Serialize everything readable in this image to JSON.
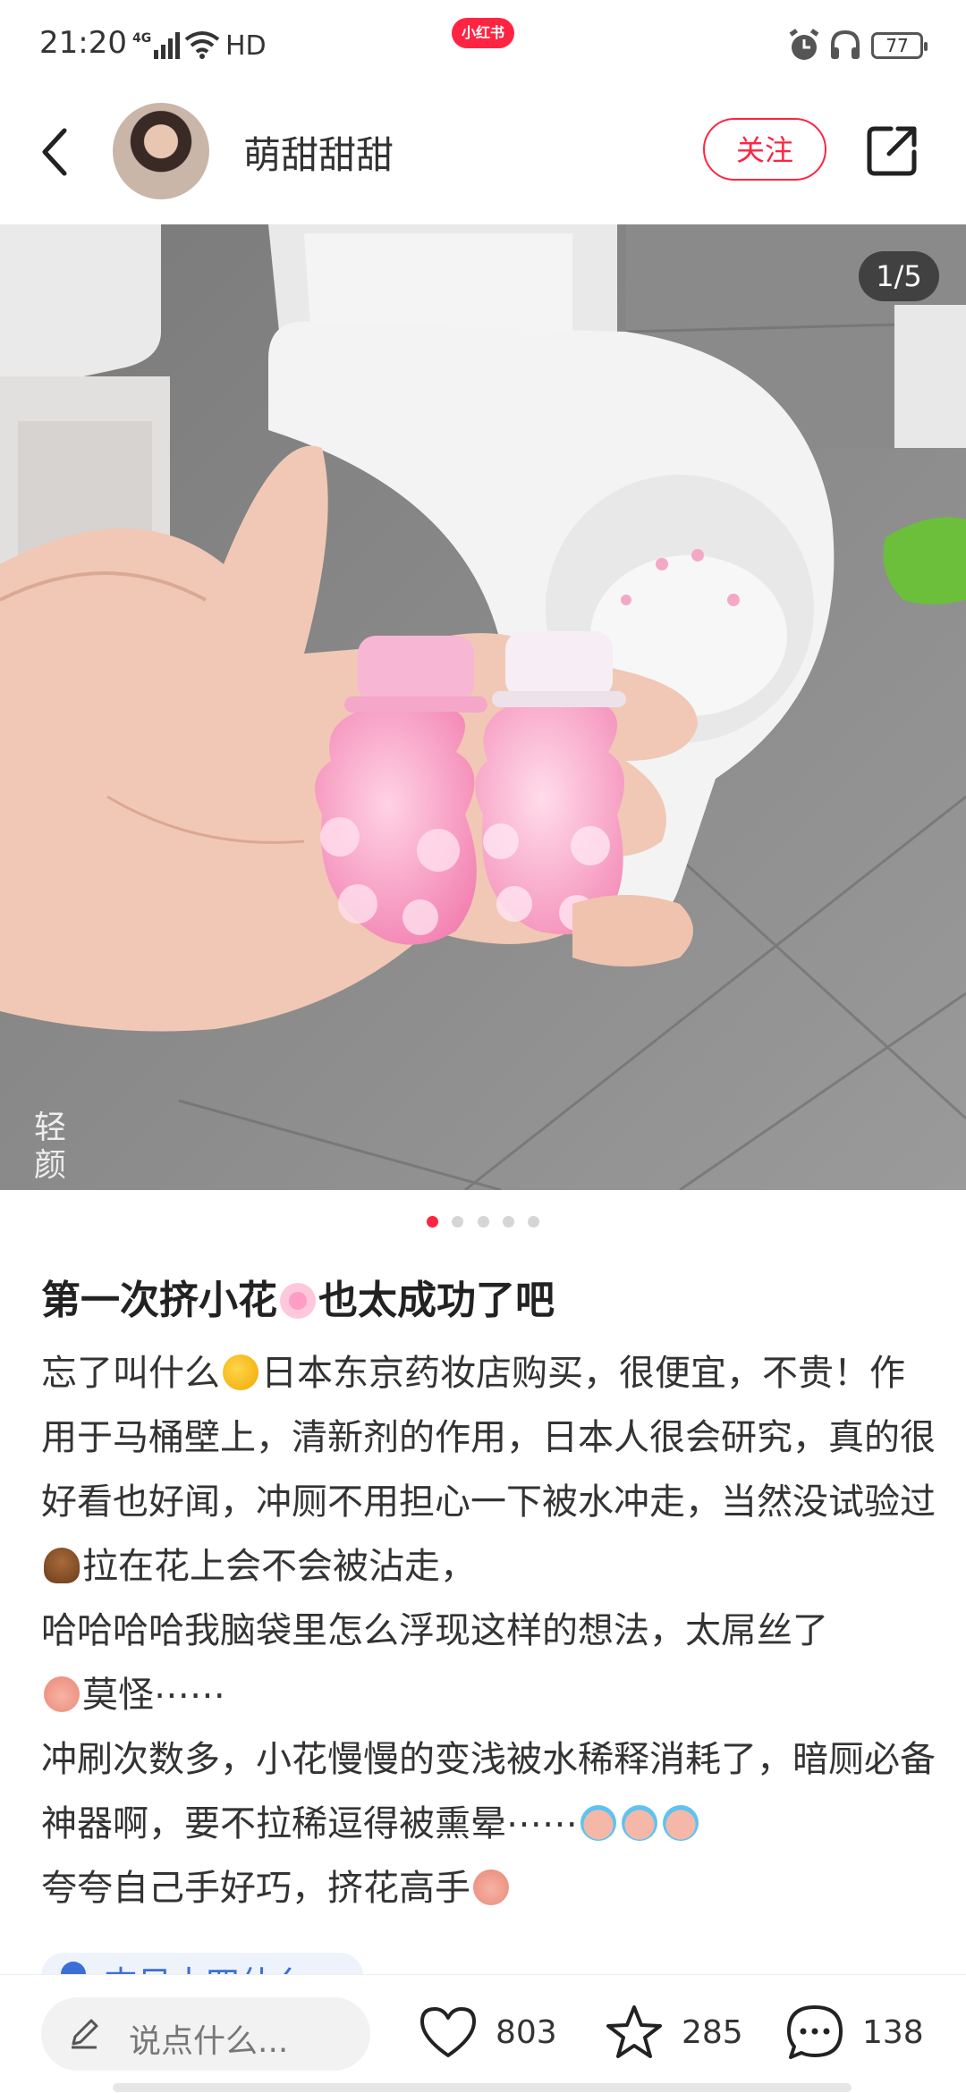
{
  "status_bar": {
    "time": "21:20",
    "network": "4G",
    "hd": "HD",
    "app_badge": "小红书",
    "battery": "77"
  },
  "header": {
    "author": "萌甜甜甜",
    "follow_label": "关注"
  },
  "media": {
    "counter": "1/5",
    "watermark_line1": "轻",
    "watermark_line2": "颜",
    "total_images": 5,
    "active_index": 1
  },
  "post": {
    "title": "第一次挤小花",
    "title_tail": "也太成功了吧",
    "p1_a": "忘了叫什么",
    "p1_b": "日本东京药妆店购买，很便宜，不贵！作用于马桶壁上，清新剂的作用，日本人很会研究，真的很好看也好闻，冲厕不用担心一下被水冲走，当然没试验过",
    "p1_c": "拉在花上会不会被沾走，",
    "p2_a": "哈哈哈哈我脑袋里怎么浮现这样的想法，太屌丝了",
    "p2_b": "莫怪⋯⋯",
    "p3_a": "冲刷次数多，小花慢慢的变浅被水稀释消耗了，暗厕必备神器啊，要不拉稀逗得被熏晕⋯⋯",
    "p4_a": "夸夸自己手好巧，挤花高手",
    "tag_partial": "杰目十四什么"
  },
  "bottom_bar": {
    "comment_placeholder": "说点什么...",
    "likes": "803",
    "collects": "285",
    "comments": "138"
  },
  "colors": {
    "accent": "#ff2442",
    "text": "#333333"
  }
}
